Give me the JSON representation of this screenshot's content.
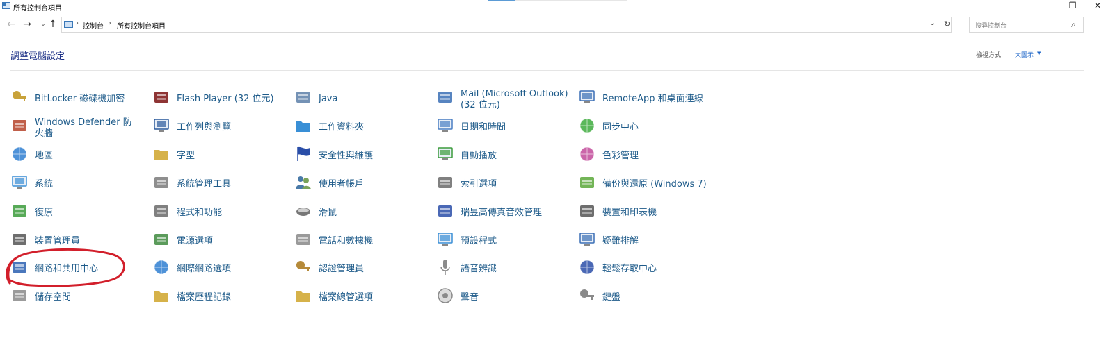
{
  "window": {
    "title": "所有控制台項目",
    "minimize_symbol": "—",
    "maximize_symbol": "❐",
    "close_symbol": "✕"
  },
  "nav": {
    "back": "←",
    "forward": "→",
    "recent": "⌄",
    "up": "↑",
    "breadcrumb": [
      "控制台",
      "所有控制台項目"
    ],
    "crumb_sep": "›",
    "dropdown": "⌄",
    "refresh": "↻",
    "search_placeholder": "搜尋控制台",
    "search_icon": "⌕"
  },
  "header": {
    "title": "調整電腦設定",
    "view_label": "檢視方式:",
    "view_value": "大圖示",
    "view_caret": "▼"
  },
  "items": [
    {
      "label": "BitLocker 磁碟機加密",
      "icon": "key-icon",
      "color": "#c8a23a"
    },
    {
      "label": "Windows Defender 防火牆",
      "icon": "firewall-icon",
      "color": "#b5432a"
    },
    {
      "label": "地區",
      "icon": "globe-clock-icon",
      "color": "#2f7fd1"
    },
    {
      "label": "系統",
      "icon": "computer-icon",
      "color": "#3a8fd6"
    },
    {
      "label": "復原",
      "icon": "recovery-icon",
      "color": "#3b9b3b"
    },
    {
      "label": "裝置管理員",
      "icon": "device-manager-icon",
      "color": "#555555"
    },
    {
      "label": "網路和共用中心",
      "icon": "network-icon",
      "color": "#2a5fb0"
    },
    {
      "label": "儲存空間",
      "icon": "storage-icon",
      "color": "#8a8a8a"
    },
    {
      "label": "Flash Player (32 位元)",
      "icon": "flash-icon",
      "color": "#7a1010"
    },
    {
      "label": "工作列與瀏覽",
      "icon": "taskbar-icon",
      "color": "#2b5a9c"
    },
    {
      "label": "字型",
      "icon": "fonts-icon",
      "color": "#d6b24a"
    },
    {
      "label": "系統管理工具",
      "icon": "admin-tools-icon",
      "color": "#7a7a7a"
    },
    {
      "label": "程式和功能",
      "icon": "programs-icon",
      "color": "#6a6a6a"
    },
    {
      "label": "電源選項",
      "icon": "power-icon",
      "color": "#3e8a3e"
    },
    {
      "label": "網際網路選項",
      "icon": "internet-options-icon",
      "color": "#2f7fd1"
    },
    {
      "label": "檔案歷程記錄",
      "icon": "file-history-icon",
      "color": "#d6b24a"
    },
    {
      "label": "Java",
      "icon": "java-icon",
      "color": "#5c7fa8"
    },
    {
      "label": "工作資料夾",
      "icon": "work-folders-icon",
      "color": "#3a8fd6"
    },
    {
      "label": "安全性與維護",
      "icon": "flag-icon",
      "color": "#2a4ea8"
    },
    {
      "label": "使用者帳戶",
      "icon": "users-icon",
      "color": "#4a7aa8"
    },
    {
      "label": "滑鼠",
      "icon": "mouse-icon",
      "color": "#777777"
    },
    {
      "label": "電話和數據機",
      "icon": "phone-modem-icon",
      "color": "#888888"
    },
    {
      "label": "認證管理員",
      "icon": "credential-icon",
      "color": "#b58a3a"
    },
    {
      "label": "檔案總管選項",
      "icon": "explorer-options-icon",
      "color": "#d6b24a"
    },
    {
      "label": "Mail (Microsoft Outlook) (32 位元)",
      "icon": "mail-icon",
      "color": "#3a6fb5"
    },
    {
      "label": "日期和時間",
      "icon": "calendar-icon",
      "color": "#4a7fc4"
    },
    {
      "label": "自動播放",
      "icon": "autoplay-icon",
      "color": "#3b9b3b"
    },
    {
      "label": "索引選項",
      "icon": "indexing-icon",
      "color": "#6a6a6a"
    },
    {
      "label": "瑞昱高傳真音效管理",
      "icon": "realtek-icon",
      "color": "#2a4ea8"
    },
    {
      "label": "預設程式",
      "icon": "default-programs-icon",
      "color": "#3a8fd6"
    },
    {
      "label": "語音辨識",
      "icon": "microphone-icon",
      "color": "#8a8a8a"
    },
    {
      "label": "聲音",
      "icon": "speaker-icon",
      "color": "#8a8a8a"
    },
    {
      "label": "RemoteApp 和桌面連線",
      "icon": "remoteapp-icon",
      "color": "#3a6fb5"
    },
    {
      "label": "同步中心",
      "icon": "sync-icon",
      "color": "#3eab3e"
    },
    {
      "label": "色彩管理",
      "icon": "color-management-icon",
      "color": "#c24a9a"
    },
    {
      "label": "備份與還原 (Windows 7)",
      "icon": "backup-icon",
      "color": "#5aa83a"
    },
    {
      "label": "裝置和印表機",
      "icon": "printer-icon",
      "color": "#555555"
    },
    {
      "label": "疑難排解",
      "icon": "troubleshoot-icon",
      "color": "#3a6fb5"
    },
    {
      "label": "輕鬆存取中心",
      "icon": "ease-of-access-icon",
      "color": "#2a4ea8"
    },
    {
      "label": "鍵盤",
      "icon": "keyboard-icon",
      "color": "#8a8a8a"
    }
  ],
  "annotation": {
    "color": "#d21f2b"
  }
}
